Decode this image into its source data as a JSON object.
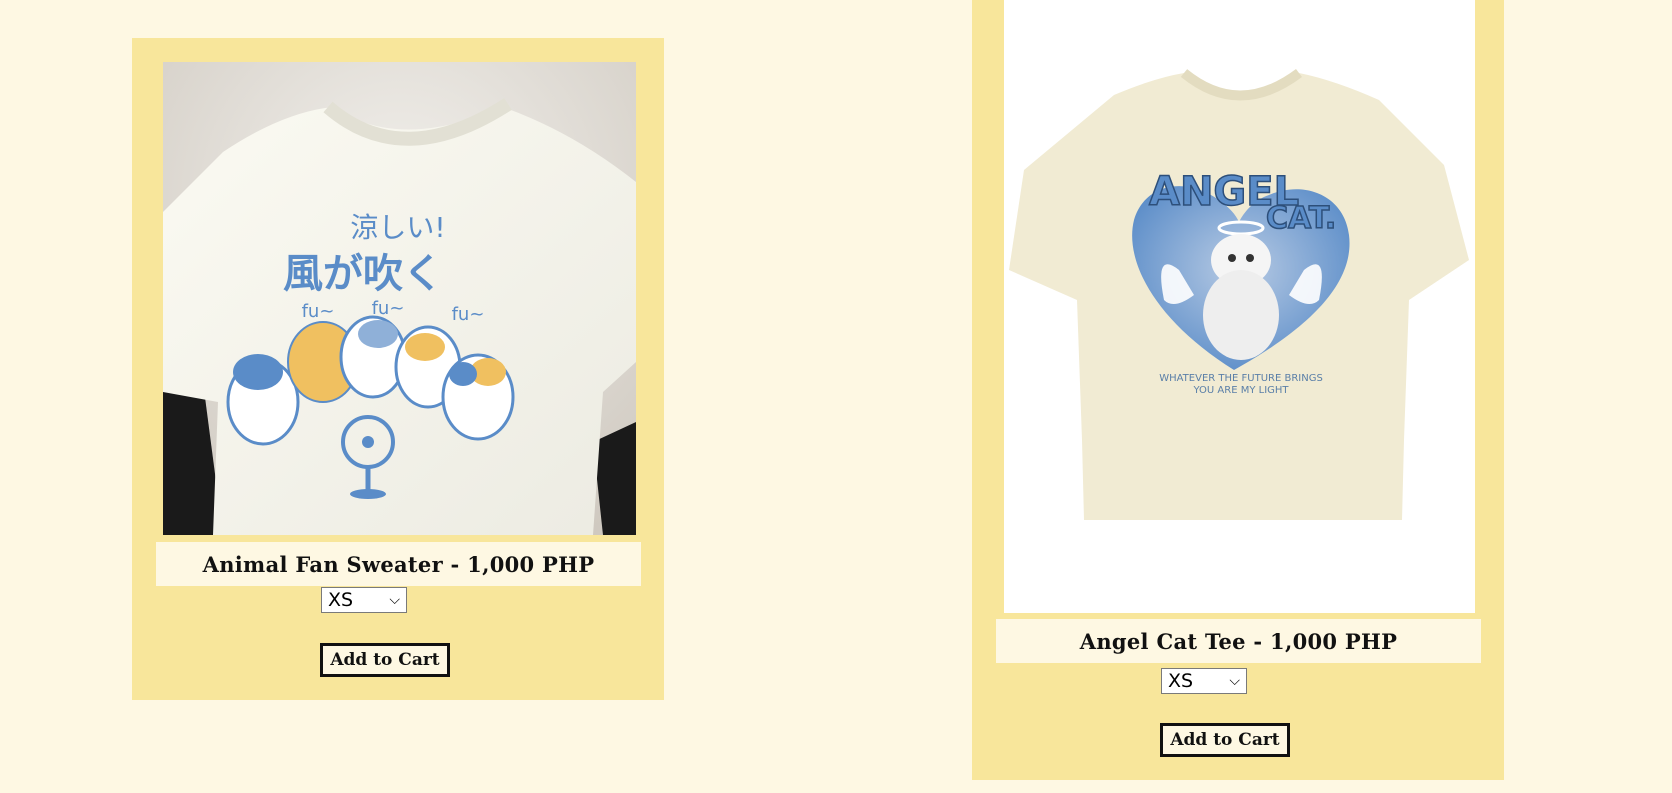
{
  "products": [
    {
      "title": "Animal Fan Sweater - 1,000 PHP",
      "size_selected": "XS",
      "add_to_cart_label": "Add to Cart",
      "image_text": {
        "line1": "涼しい!",
        "line2": "風が吹く",
        "sound": "fu~"
      }
    },
    {
      "title": "Angel Cat Tee - 1,000 PHP",
      "size_selected": "XS",
      "add_to_cart_label": "Add to Cart",
      "image_text": {
        "headline1": "ANGEL",
        "headline2": "CAT.",
        "tagline1": "WHATEVER THE FUTURE BRINGS",
        "tagline2": "YOU ARE MY LIGHT"
      }
    }
  ],
  "colors": {
    "page_bg": "#fef8e3",
    "card_bg": "#f8e69b",
    "print_blue": "#5a8cc8",
    "print_orange": "#f0c060"
  }
}
